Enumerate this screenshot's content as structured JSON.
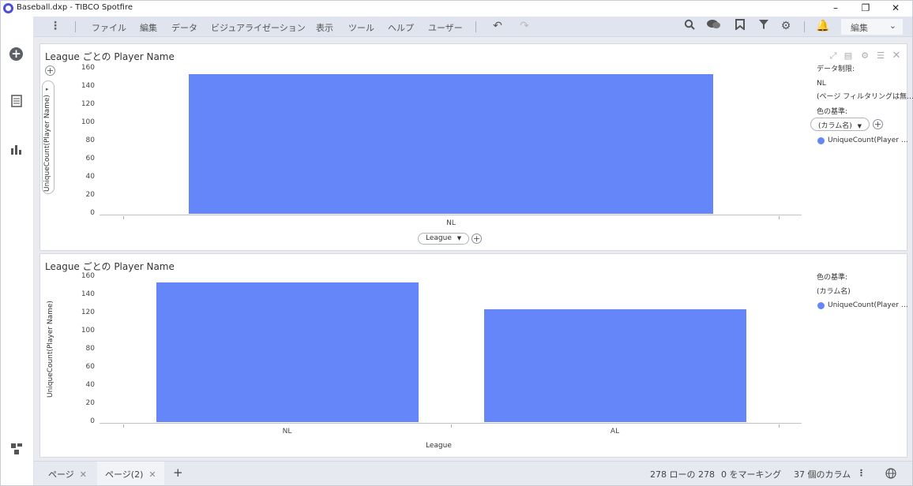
{
  "window": {
    "title": "Baseball.dxp - TIBCO Spotfire",
    "min": "–",
    "restore": "❐",
    "close": "✕"
  },
  "sidebar": {
    "add": "+",
    "data": "≡",
    "viz": "📊",
    "bottom": "⧉"
  },
  "menu": {
    "items": [
      "ファイル",
      "編集",
      "データ",
      "ビジュアライゼーション",
      "表示",
      "ツール",
      "ヘルプ",
      "ユーザー"
    ],
    "mode": "編集"
  },
  "viz1": {
    "title": "League ごとの Player Name",
    "ylabel": "UniqueCount(Player Name)",
    "xaxis_pill": "League",
    "legend": {
      "limit_label": "データ制限:",
      "limit_value": "NL",
      "limit_note": "(ページ フィルタリングは無…",
      "color_label": "色の基準:",
      "color_pill": "(カラム名)",
      "series": "UniqueCount(Player …"
    }
  },
  "viz2": {
    "title": "League ごとの Player Name",
    "ylabel": "UniqueCount(Player Name)",
    "xlabel": "League",
    "legend": {
      "color_label": "色の基準:",
      "color_value": "(カラム名)",
      "series": "UniqueCount(Player …"
    }
  },
  "chart_data": [
    {
      "type": "bar",
      "title": "League ごとの Player Name",
      "categories": [
        "NL"
      ],
      "values": [
        154
      ],
      "ylabel": "UniqueCount(Player Name)",
      "xlabel": "League",
      "ylim": [
        0,
        160
      ],
      "yticks": [
        0,
        20,
        40,
        60,
        80,
        100,
        120,
        140,
        160
      ],
      "color": "#6586f8"
    },
    {
      "type": "bar",
      "title": "League ごとの Player Name",
      "categories": [
        "NL",
        "AL"
      ],
      "values": [
        154,
        124
      ],
      "ylabel": "UniqueCount(Player Name)",
      "xlabel": "League",
      "ylim": [
        0,
        160
      ],
      "yticks": [
        0,
        20,
        40,
        60,
        80,
        100,
        120,
        140,
        160
      ],
      "color": "#6586f8"
    }
  ],
  "bottom": {
    "tabs": [
      {
        "label": "ページ"
      },
      {
        "label": "ページ(2)"
      }
    ],
    "add": "+",
    "rows": "278 ローの 278",
    "marked": "0 をマーキング",
    "columns": "37 個のカラム"
  }
}
